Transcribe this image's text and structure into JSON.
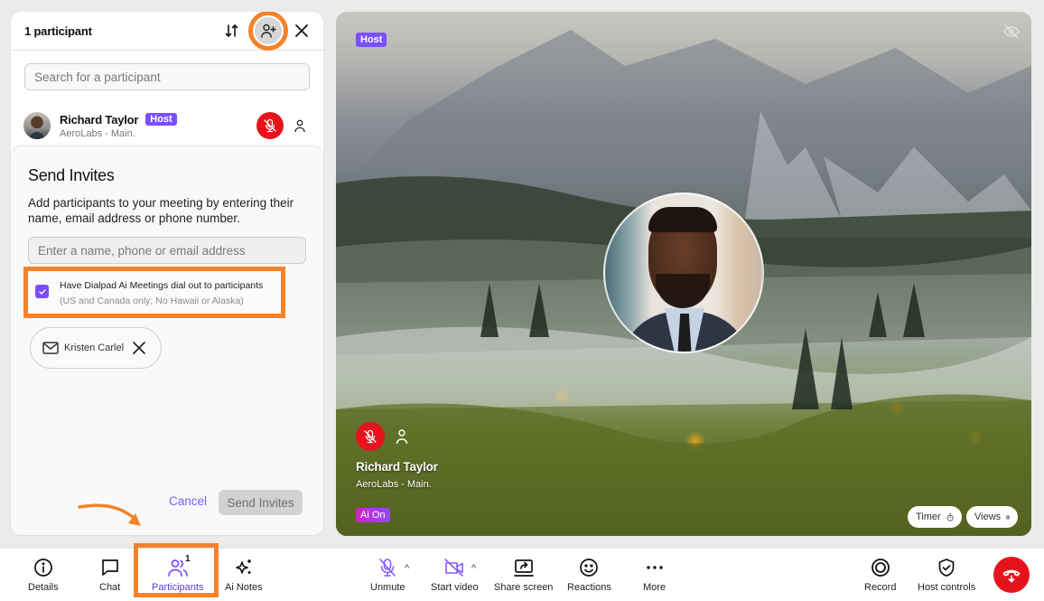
{
  "colors": {
    "accent": "#7b4fff",
    "danger": "#e5141c",
    "annotation": "#f5822a",
    "ai_gradient_start": "#d41fc6",
    "ai_gradient_end": "#8f4bff"
  },
  "panel": {
    "title": "1 participant",
    "sort_icon": "sort-arrows-icon",
    "add_participant_icon": "add-person-icon",
    "close_icon": "close-icon",
    "search": {
      "placeholder": "Search for a participant",
      "value": ""
    },
    "participants": [
      {
        "name": "Richard Taylor",
        "badge": "Host",
        "org": "AeroLabs - Main.",
        "muted": true
      }
    ]
  },
  "invite": {
    "title": "Send Invites",
    "description": "Add participants to your meeting by entering their name, email address or phone number.",
    "input": {
      "placeholder": "Enter a name, phone or email address",
      "value": ""
    },
    "dialout": {
      "checked": true,
      "label": "Have Dialpad Ai Meetings dial out to participants",
      "sublabel": "(US and Canada only; No Hawaii or Alaska)"
    },
    "chips": [
      {
        "icon": "mail-icon",
        "label": "Kristen Carlel"
      }
    ],
    "cancel_label": "Cancel",
    "send_label": "Send Invites"
  },
  "stage": {
    "host_tag": "Host",
    "participant_name": "Richard Taylor",
    "participant_org": "AeroLabs - Main.",
    "ai_badge": "Ai On",
    "timer_label": "Timer",
    "views_label": "Views"
  },
  "toolbar": {
    "left": [
      {
        "id": "details",
        "label": "Details",
        "icon": "info-icon"
      },
      {
        "id": "chat",
        "label": "Chat",
        "icon": "chat-bubble-icon"
      },
      {
        "id": "participants",
        "label": "Participants",
        "icon": "people-icon",
        "count": "1",
        "active": true
      },
      {
        "id": "ai-notes",
        "label": "Ai Notes",
        "icon": "sparkle-icon"
      }
    ],
    "center": [
      {
        "id": "unmute",
        "label": "Unmute",
        "icon": "mic-off-icon"
      },
      {
        "id": "start-video",
        "label": "Start video",
        "icon": "video-off-icon"
      },
      {
        "id": "share-screen",
        "label": "Share screen",
        "icon": "share-screen-icon"
      },
      {
        "id": "reactions",
        "label": "Reactions",
        "icon": "smiley-icon"
      },
      {
        "id": "more",
        "label": "More",
        "icon": "ellipsis-icon"
      }
    ],
    "right": [
      {
        "id": "record",
        "label": "Record",
        "icon": "record-icon"
      },
      {
        "id": "host-controls",
        "label": "Host controls",
        "icon": "shield-check-icon"
      }
    ],
    "hangup_icon": "hang-up-icon"
  }
}
